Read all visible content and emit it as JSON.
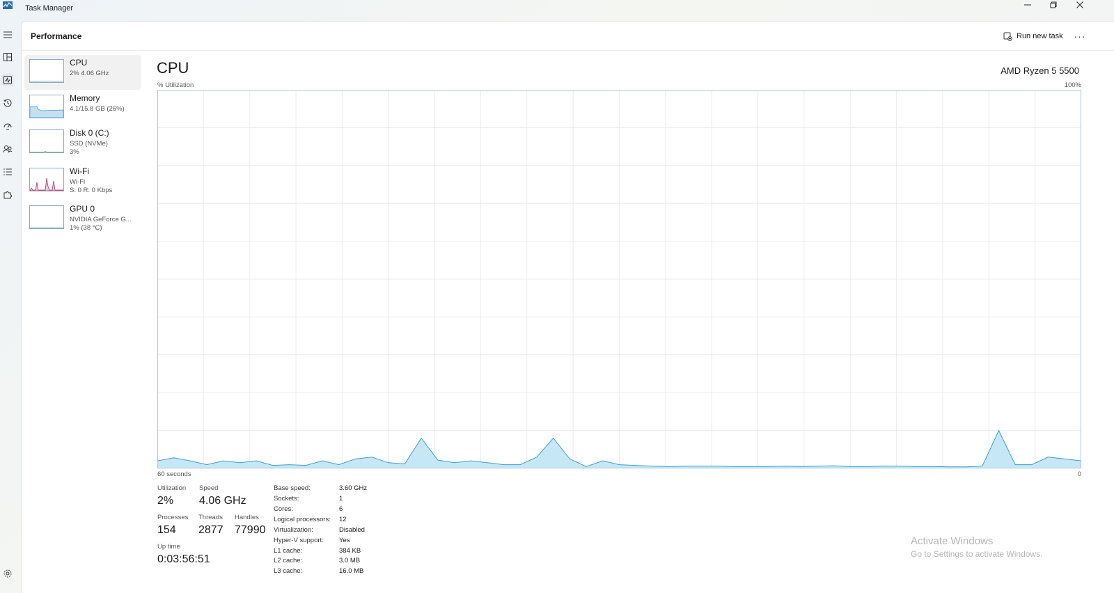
{
  "window": {
    "title": "Task Manager"
  },
  "header": {
    "title": "Performance",
    "run_task_label": "Run new task",
    "more_label": "···"
  },
  "sidebar": {
    "items": [
      {
        "name": "CPU",
        "sub1": "2%  4.06 GHz",
        "sub2": ""
      },
      {
        "name": "Memory",
        "sub1": "4.1/15.8 GB (26%)",
        "sub2": ""
      },
      {
        "name": "Disk 0 (C:)",
        "sub1": "SSD (NVMe)",
        "sub2": "3%"
      },
      {
        "name": "Wi-Fi",
        "sub1": "Wi-Fi",
        "sub2": "S: 0 R: 0 Kbps"
      },
      {
        "name": "GPU 0",
        "sub1": "NVIDIA GeForce G...",
        "sub2": "1% (38 °C)"
      }
    ]
  },
  "cpu": {
    "title": "CPU",
    "model": "AMD Ryzen 5 5500",
    "util_label": "% Utilization",
    "util_max": "100%",
    "x_left": "60 seconds",
    "x_right": "0"
  },
  "chart_data": {
    "type": "area",
    "x_label": "60 seconds",
    "ylim": [
      0,
      100
    ],
    "grid": true,
    "values": [
      2,
      2.8,
      2,
      1,
      2,
      1.5,
      2,
      0.8,
      1,
      0.8,
      2,
      1,
      2.5,
      3,
      1.5,
      1.2,
      8,
      2.2,
      1.5,
      2,
      1.5,
      1,
      1,
      3,
      8,
      2.5,
      0.5,
      2,
      1,
      0.8,
      0.6,
      0.5,
      0.6,
      0.6,
      0.6,
      0.5,
      0.5,
      0.5,
      0.6,
      0.5,
      0.6,
      0.7,
      0.5,
      0.5,
      0.6,
      0.6,
      0.5,
      0.5,
      0.4,
      0.4,
      0.6,
      10,
      1,
      1,
      3,
      2.5,
      2
    ]
  },
  "stats": {
    "utilization_label": "Utilization",
    "utilization_value": "2%",
    "speed_label": "Speed",
    "speed_value": "4.06 GHz",
    "processes_label": "Processes",
    "processes_value": "154",
    "threads_label": "Threads",
    "threads_value": "2877",
    "handles_label": "Handles",
    "handles_value": "77990",
    "uptime_label": "Up time",
    "uptime_value": "0:03:56:51"
  },
  "specs": [
    {
      "label": "Base speed:",
      "value": "3.60 GHz"
    },
    {
      "label": "Sockets:",
      "value": "1"
    },
    {
      "label": "Cores:",
      "value": "6"
    },
    {
      "label": "Logical processors:",
      "value": "12"
    },
    {
      "label": "Virtualization:",
      "value": "Disabled"
    },
    {
      "label": "Hyper-V support:",
      "value": "Yes"
    },
    {
      "label": "L1 cache:",
      "value": "384 KB"
    },
    {
      "label": "L2 cache:",
      "value": "3.0 MB"
    },
    {
      "label": "L3 cache:",
      "value": "16.0 MB"
    }
  ],
  "watermark": {
    "title": "Activate Windows",
    "subtitle": "Go to Settings to activate Windows."
  },
  "colors": {
    "cpu_line": "#3b9fd1",
    "cpu_fill": "#c6e7f6",
    "wifi_line": "#b0306a",
    "grid": "#ececec",
    "graph_border": "#a9c6dd"
  }
}
